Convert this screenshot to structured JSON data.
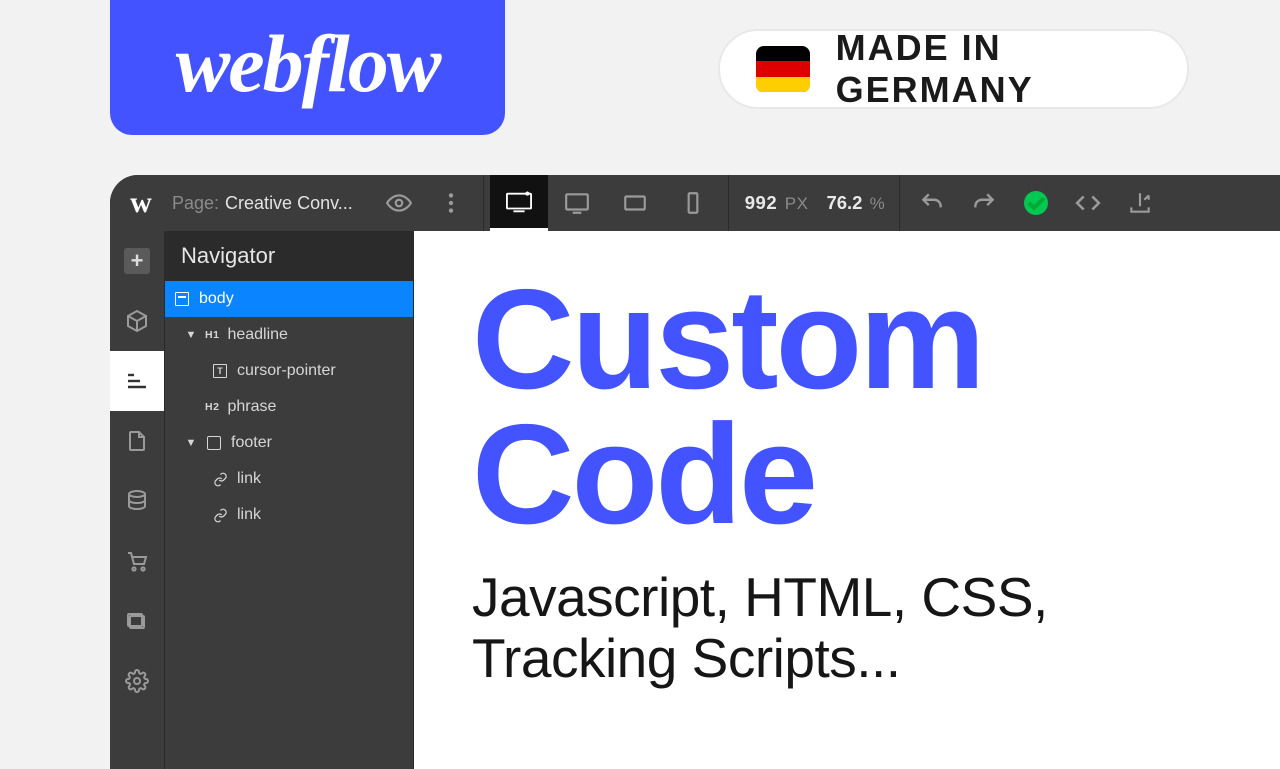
{
  "badges": {
    "webflow_logo_text": "webflow",
    "germany_label": "MADE IN GERMANY"
  },
  "topbar": {
    "page_prefix": "Page:",
    "page_name": "Creative Conv...",
    "width_value": "992",
    "width_unit": "PX",
    "zoom_value": "76.2",
    "zoom_unit": "%"
  },
  "navigator": {
    "title": "Navigator",
    "tree": {
      "body": "body",
      "h1": "headline",
      "cursor": "cursor-pointer",
      "h2": "phrase",
      "footer": "footer",
      "link1": "link",
      "link2": "link"
    }
  },
  "promo": {
    "line1": "Custom",
    "line2": "Code",
    "sub1": "Javascript, HTML, CSS,",
    "sub2": "Tracking Scripts..."
  }
}
